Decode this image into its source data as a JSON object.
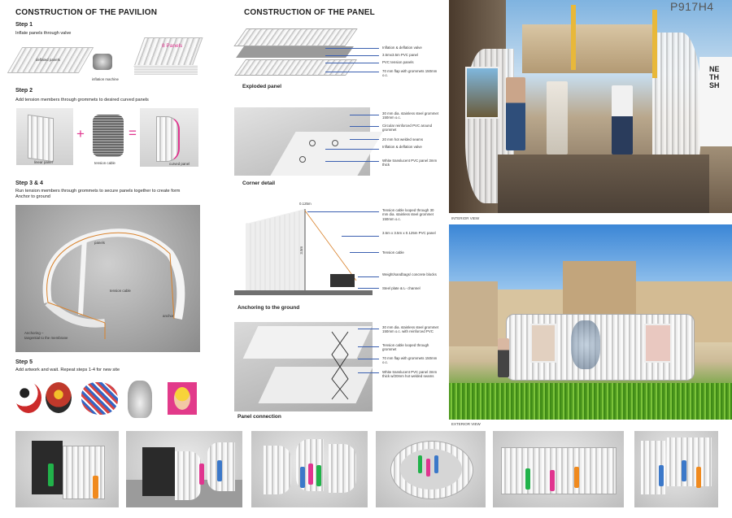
{
  "pavilion": {
    "title": "CONSTRUCTION OF THE PAVILION",
    "step1": {
      "title": "Step 1",
      "desc": "Inflate panels through valve",
      "label_deflated": "deflated panels",
      "label_machine": "inflation machine",
      "label_panels": "8 Panels"
    },
    "step2": {
      "title": "Step 2",
      "desc": "Add tension members through grommets to desired curved panels",
      "label_linear": "linear panel",
      "label_cable": "tension cable",
      "label_curved": "curved panel",
      "plus": "+",
      "equals": "="
    },
    "step34": {
      "title": "Step 3 & 4",
      "desc1": "Run tension members through grommets to secure panels together to create form",
      "desc2": "Anchor to ground",
      "label_panels": "panels",
      "label_tension": "tension cable",
      "label_anchor": "anchor",
      "label_anchoring": "Anchoring –",
      "label_anchoring2": "tangential to the membrane"
    },
    "step5": {
      "title": "Step 5",
      "desc": "Add artwork and wait. Repeat steps 1-4 for new site"
    }
  },
  "panel": {
    "title": "CONSTRUCTION OF THE PANEL",
    "exploded": {
      "caption": "Exploded panel",
      "notes": [
        "Inflation & deflation valve",
        "3.5mx3.5m PVC panel",
        "PVC tension panels",
        "70 mm flap with grommets 150mm o.c."
      ]
    },
    "corner": {
      "caption": "Corner detail",
      "notes": [
        "30 mm dia. stainless steel grommet 150mm o.c.",
        "Circular reinforced PVC around grommet",
        "20 mm hot welded seams",
        "Inflation & deflation valve",
        "White translucent PVC panel 3mm thick"
      ]
    },
    "anchoring": {
      "caption": "Anchoring to the ground",
      "dim_top": "0.125m",
      "dim_side": "3.5m",
      "notes": [
        "Tension cable looped through 30 mm dia. stainless steel grommet 150mm o.c.",
        "3.5m x 3.5m x 0.125m PVC panel",
        "Tension cable",
        "Weight/sandbags/ concrete blocks",
        "Steel plate & L- channel"
      ]
    },
    "connection": {
      "caption": "Panel connection",
      "notes": [
        "30 mm dia. stainless steel grommet 150mm o.c. with reinforced PVC",
        "Tension cable looped through grommet",
        "70 mm flap with grommets 150mm o.c.",
        "White translucent PVC panel 3mm thick w/20mm hot welded seams"
      ]
    }
  },
  "views": {
    "code": "P917H4",
    "interior": "INTERIOR VIEW",
    "exterior": "EXTERIOR VIEW",
    "poster_text": [
      "NE",
      "TH",
      "SH"
    ]
  },
  "colors": {
    "accent_pink": "#e0358f",
    "callout_blue": "#3a5fb0",
    "cable_orange": "#d9822b"
  }
}
